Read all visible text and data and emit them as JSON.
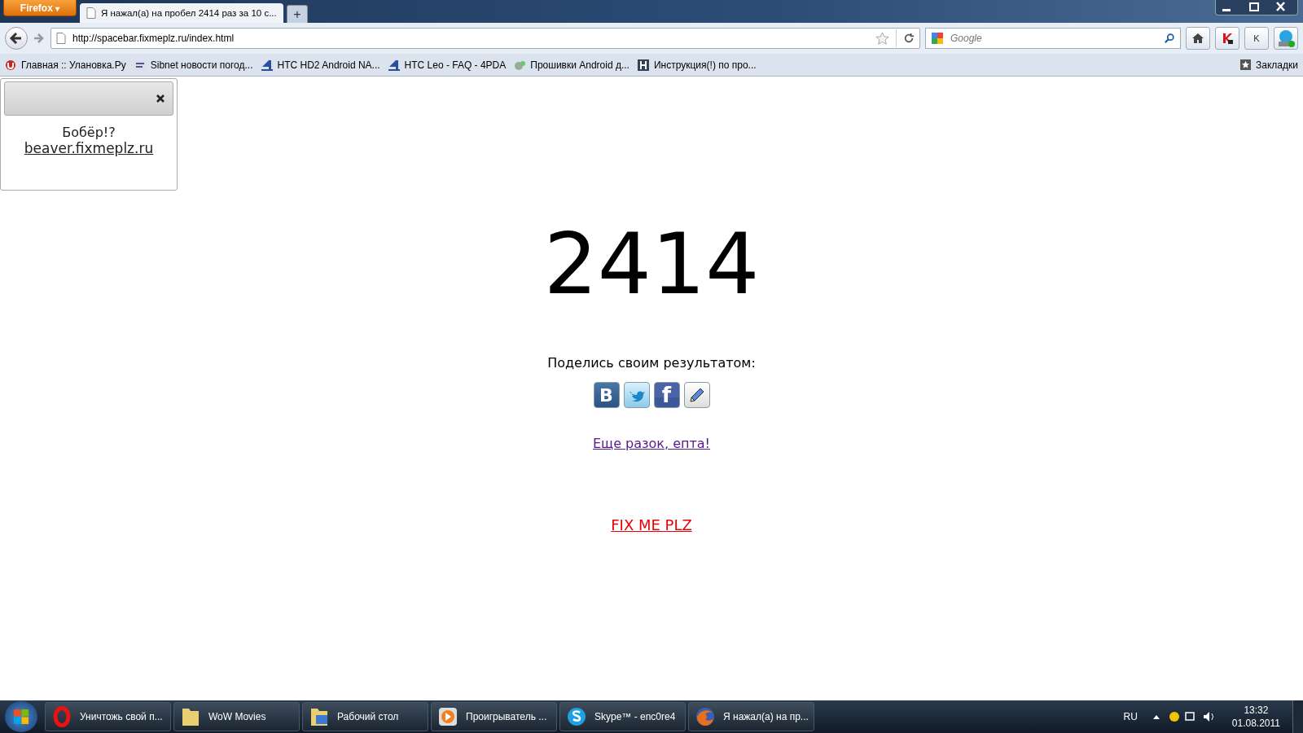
{
  "browser": {
    "app_menu": "Firefox",
    "app_menu_caret": "▾",
    "tabs": [
      {
        "title": "Я нажал(а) на пробел 2414 раз за 10 с...",
        "selected": true
      }
    ],
    "new_tab": "+",
    "address": "http://spacebar.fixmeplz.ru/index.html",
    "search_placeholder": "Google",
    "k_button": "K",
    "bookmarks": [
      {
        "kind": "ulanovka",
        "label": "Главная :: Улановка.Ру"
      },
      {
        "kind": "sibnet",
        "label": "Sibnet новости погод..."
      },
      {
        "kind": "fourpda",
        "label": "HTC HD2 Android NA..."
      },
      {
        "kind": "fourpda",
        "label": "HTC Leo - FAQ - 4PDA"
      },
      {
        "kind": "android",
        "label": "Прошивки Android д..."
      },
      {
        "kind": "h",
        "label": "Инструкция(!) по про..."
      }
    ],
    "bookmarks_menu": "Закладки"
  },
  "page": {
    "popup": {
      "title": "Бобёр!?",
      "link": "beaver.fixmeplz.ru"
    },
    "count": "2414",
    "share_prompt": "Поделись своим результатом:",
    "share_buttons": [
      {
        "kind": "vk",
        "glyph": "В"
      },
      {
        "kind": "twitter"
      },
      {
        "kind": "facebook",
        "glyph": "f"
      },
      {
        "kind": "pencil"
      }
    ],
    "again_link": "Еще разок, епта!",
    "fix_link": "FIX ME PLZ"
  },
  "taskbar": {
    "items": [
      {
        "kind": "opera",
        "label": "Уничтожь свой п..."
      },
      {
        "kind": "folder",
        "label": "WoW Movies"
      },
      {
        "kind": "desktop",
        "label": "Рабочий стол"
      },
      {
        "kind": "player",
        "label": "Проигрыватель ..."
      },
      {
        "kind": "skype",
        "label": "Skype™ - enc0re4"
      },
      {
        "kind": "firefox",
        "label": "Я нажал(а) на пр..."
      }
    ],
    "language": "RU",
    "time": "13:32",
    "date": "01.08.2011"
  }
}
